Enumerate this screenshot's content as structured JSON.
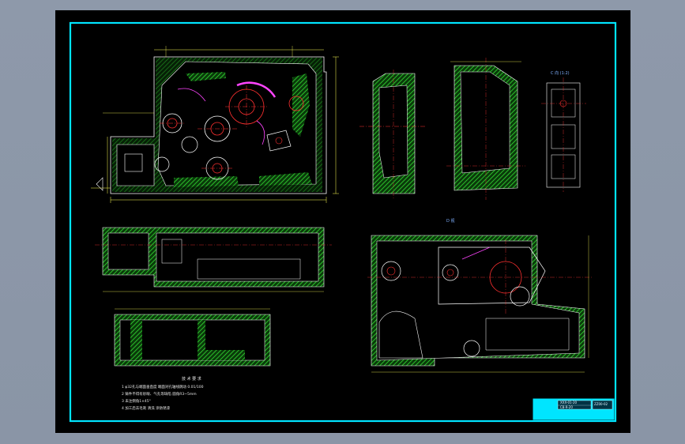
{
  "drawing": {
    "section_labels": {
      "top_right_view": "C 向 (1:2)",
      "lower_right_view": "D 视"
    },
    "notes": {
      "title": "技 术 要 求",
      "lines": [
        "1  φ32孔与端面垂直度 端面对孔轴线跳动 0.01/100",
        "2  铸件不得有砂眼、气孔等缺陷 圆角R3~5mm",
        "3  未注倒角1×45°",
        "4  加工后去毛刺 清洗 涂防锈漆"
      ]
    },
    "title_block": {
      "cell_1": "XXX-01-20",
      "cell_2": "C8-9-20",
      "cell_3": "ZZ00-02"
    },
    "colors": {
      "outline": "#ffffff",
      "hatch": "#22cc22",
      "dimension": "#ffff55",
      "center": "#ff3030",
      "frame": "#00e5ff",
      "circle": "#ff3030",
      "magenta": "#ff44ff"
    }
  }
}
